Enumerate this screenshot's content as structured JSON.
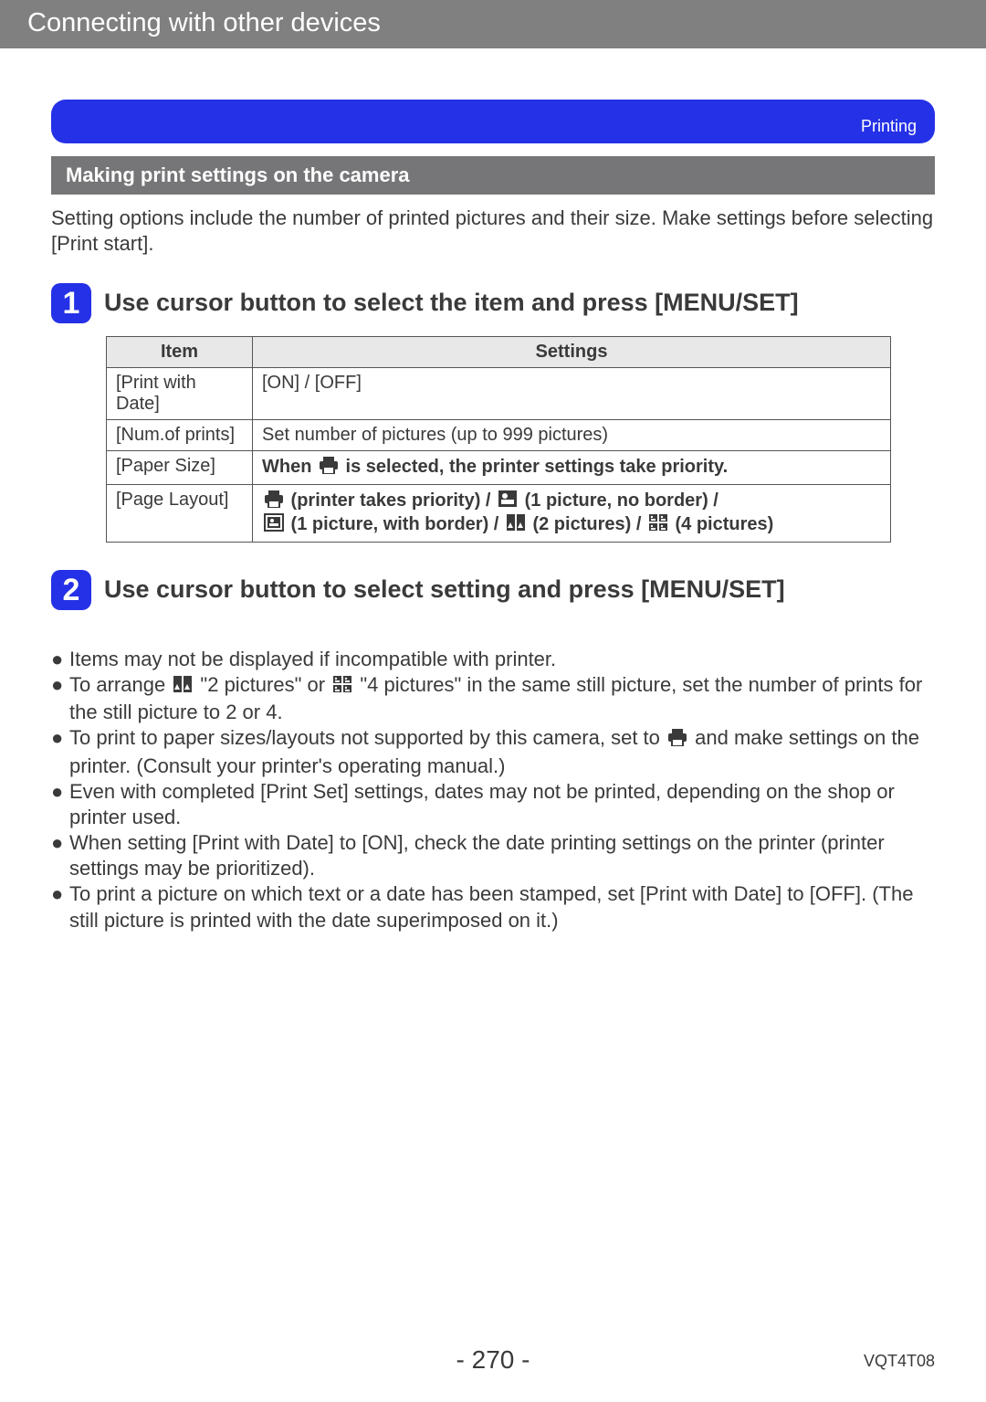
{
  "header": {
    "title": "Connecting with other devices"
  },
  "banner": {
    "label": "Printing"
  },
  "subbar": {
    "title": "Making print settings on the camera"
  },
  "intro": "Setting options include the number of printed pictures and their size. Make settings before selecting [Print start].",
  "steps": {
    "s1": {
      "num": "1",
      "title": "Use cursor button to select the item and press [MENU/SET]"
    },
    "s2": {
      "num": "2",
      "title": "Use cursor button to select setting and press [MENU/SET]"
    }
  },
  "table": {
    "head_item": "Item",
    "head_settings": "Settings",
    "rows": {
      "r0": {
        "item": "[Print with Date]",
        "setting": "[ON] / [OFF]"
      },
      "r1": {
        "item": "[Num.of prints]",
        "setting": "Set number of pictures (up to 999 pictures)"
      },
      "r2": {
        "item": "[Paper Size]",
        "setting_pre": "When ",
        "setting_post": " is selected, the printer settings take priority."
      },
      "r3": {
        "item": "[Page Layout]",
        "a": " (printer takes priority) / ",
        "b": " (1 picture, no border) / ",
        "c": " (1 picture, with border) / ",
        "d": " (2 pictures) / ",
        "e": " (4 pictures)"
      }
    }
  },
  "notes": {
    "n0": "Items may not be displayed if incompatible with printer.",
    "n1_a": "To arrange ",
    "n1_b": " \"2 pictures\" or ",
    "n1_c": " \"4 pictures\" in the same still picture, set the number of prints for the still picture to 2 or 4.",
    "n2_a": "To print to paper sizes/layouts not supported by this camera, set to ",
    "n2_b": " and make settings on the printer. (Consult your printer's operating manual.)",
    "n3": "Even with completed [Print Set] settings, dates may not be printed, depending on the shop or printer used.",
    "n4": "When setting [Print with Date] to [ON], check the date printing settings on the printer (printer settings may be prioritized).",
    "n5": "To print a picture on which text or a date has been stamped, set [Print with Date] to [OFF]. (The still picture is printed with the date superimposed on it.)"
  },
  "footer": {
    "page": "- 270 -",
    "docid": "VQT4T08"
  }
}
